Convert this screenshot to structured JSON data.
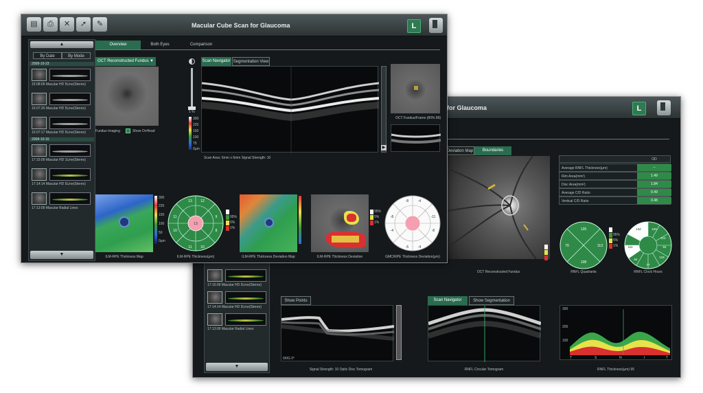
{
  "front": {
    "title": "Macular Cube Scan for Glaucoma",
    "eye": "L",
    "toolbar": [
      "print-icon",
      "printer-icon",
      "exit-icon",
      "export-icon",
      "edit-icon"
    ],
    "tabs": [
      "Overview",
      "Both Eyes",
      "Comparison"
    ],
    "sidebar": {
      "by_date": "By Date",
      "by_mode": "By Mode",
      "dates": [
        "2008-10-23",
        "2008-10-15"
      ],
      "items": [
        "15:08:09 Macular HD 5Line(Stereo)",
        "15:07:20 Macular HD 5Line(Stereo)",
        "15:07:17 Macular HD 5Line(Stereo)",
        "17:15:09 Macular HD 1Line(Stereo)",
        "17:14:14 Macular HD 5Line(Stereo)",
        "17:13:09 Macular Radial Lines"
      ]
    },
    "fundus_dropdown": "OCT Reconstructed Fundus",
    "fundus_caption": "Fundus Imaging",
    "show_onh": "Show OnHead",
    "subtabs": [
      "Scan Navigator",
      "Segmentation View"
    ],
    "scan_caption": "Scan Area: 6mm x 6mm   Signal Strength: 10",
    "side_caption": "OCT Fundus/Frame (80% 89)",
    "scale_labels": [
      "1 %",
      "300",
      "225",
      "150",
      "100",
      "75",
      "0μm"
    ],
    "maps": [
      "ILM-RPE Thickness Map",
      "ILM-RPE Thickness(μm)",
      "ILM-RPE Thickness Deviation Map",
      "ILM-RPE Thickness Deviation",
      "GMC/RPE Thickness Deviation(μm)"
    ],
    "sector_values": [
      "13",
      "12",
      "11",
      "9",
      "10",
      "8",
      "11",
      "10",
      "13"
    ],
    "white_sector_values": [
      "-8",
      "-4",
      "-8",
      "-11",
      "-4",
      "-8",
      "-5",
      "-4"
    ],
    "legend": [
      "95%",
      "5%",
      "1%"
    ],
    "cmap_labels": [
      "300",
      "225",
      "150",
      "100",
      "50",
      "0μm"
    ]
  },
  "back": {
    "title_partial": "for Glaucoma",
    "eye": "L",
    "tabs": [
      "Deviation Map",
      "Boundaries"
    ],
    "table": {
      "header": "OD",
      "rows": [
        [
          "Average RNFL Thickness(μm)",
          "--"
        ],
        [
          "Rim Area(mm²)",
          "1.49"
        ],
        [
          "Disc Area(mm²)",
          "1.84"
        ],
        [
          "Average C/D Ratio",
          "0.49"
        ],
        [
          "Vertical C/D Ratio",
          "0.48"
        ]
      ]
    },
    "fundus_caption": "OCT Reconstructed Fundus",
    "quad_caption": "RNFL Quadrants",
    "quad_values": [
      "126",
      "70",
      "113",
      "108"
    ],
    "clock_caption": "RNFL Clock Hours",
    "clock_values": [
      "100",
      "112",
      "111",
      "94",
      "119",
      "77",
      "64",
      "142"
    ],
    "legend": [
      "95%",
      "5%",
      "1%"
    ],
    "sidebar_items": [
      "17:15:09 Macular HD 5Line(Stereo)",
      "17:14:14 Macular HD 5Line(Stereo)",
      "17:13:09 Macular Radial Lines"
    ],
    "show_points": "Show Points",
    "scan_nav": "Scan Navigator",
    "show_seg": "Show Segmentation",
    "tomo_caption": "Signal Strength: 10   Optic Disc Tomogram",
    "rnfl_caption": "RNFL Circular Tomogram",
    "graph_caption": "RNFL Thickness(μm) 95",
    "graph_y": [
      "300",
      "200",
      "100"
    ],
    "graph_x": [
      "T",
      "S",
      "N",
      "I",
      "T"
    ],
    "angle": "0/0G  0°"
  }
}
